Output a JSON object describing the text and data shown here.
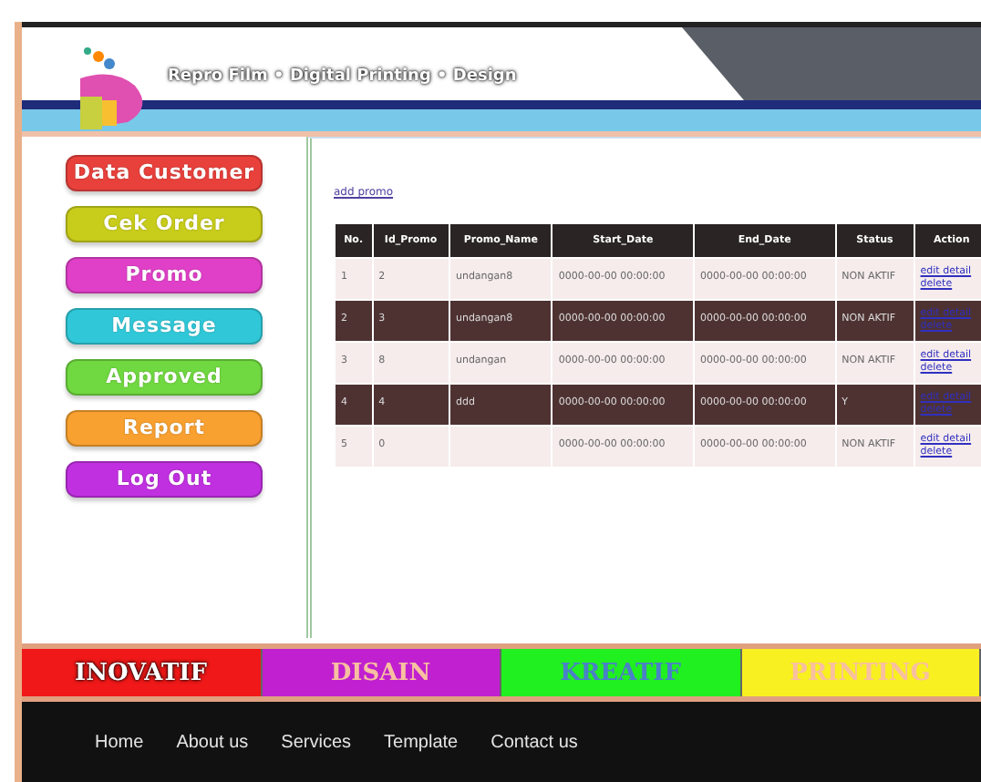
{
  "header": {
    "tagline": "Repro Film • Digital Printing • Design"
  },
  "menu": [
    {
      "label": "Data Customer",
      "color": "#e8413c"
    },
    {
      "label": "Cek Order",
      "color": "#c8cc1a"
    },
    {
      "label": "Promo",
      "color": "#e040c8"
    },
    {
      "label": "Message",
      "color": "#30c8d8"
    },
    {
      "label": "Approved",
      "color": "#70d840"
    },
    {
      "label": "Report",
      "color": "#f8a030"
    },
    {
      "label": "Log Out",
      "color": "#c030e0"
    }
  ],
  "content": {
    "add_link": "add promo",
    "table": {
      "columns": [
        "No.",
        "Id_Promo",
        "Promo_Name",
        "Start_Date",
        "End_Date",
        "Status",
        "Action"
      ],
      "rows": [
        {
          "cells": [
            "1",
            "2",
            "undangan8",
            "0000-00-00 00:00:00",
            "0000-00-00 00:00:00",
            "NON AKTIF"
          ],
          "actions": [
            "edit detail",
            "delete"
          ]
        },
        {
          "cells": [
            "2",
            "3",
            "undangan8",
            "0000-00-00 00:00:00",
            "0000-00-00 00:00:00",
            "NON AKTIF"
          ],
          "actions": [
            "edit detail",
            "delete"
          ]
        },
        {
          "cells": [
            "3",
            "8",
            "undangan",
            "0000-00-00 00:00:00",
            "0000-00-00 00:00:00",
            "NON AKTIF"
          ],
          "actions": [
            "edit detail",
            "delete"
          ]
        },
        {
          "cells": [
            "4",
            "4",
            "ddd",
            "0000-00-00 00:00:00",
            "0000-00-00 00:00:00",
            "Y"
          ],
          "actions": [
            "edit detail",
            "delete"
          ]
        },
        {
          "cells": [
            "5",
            "0",
            "",
            "0000-00-00 00:00:00",
            "0000-00-00 00:00:00",
            "NON AKTIF"
          ],
          "actions": [
            "edit detail",
            "delete"
          ]
        }
      ]
    }
  },
  "banner": [
    {
      "label": "INOVATIF",
      "color": "#f01818"
    },
    {
      "label": "DISAIN",
      "color": "#c020d0"
    },
    {
      "label": "KREATIF",
      "color": "#20f020"
    },
    {
      "label": "PRINTING",
      "color": "#f8f020"
    }
  ],
  "nav": [
    "Home",
    "About us",
    "Services",
    "Template",
    "Contact us"
  ]
}
